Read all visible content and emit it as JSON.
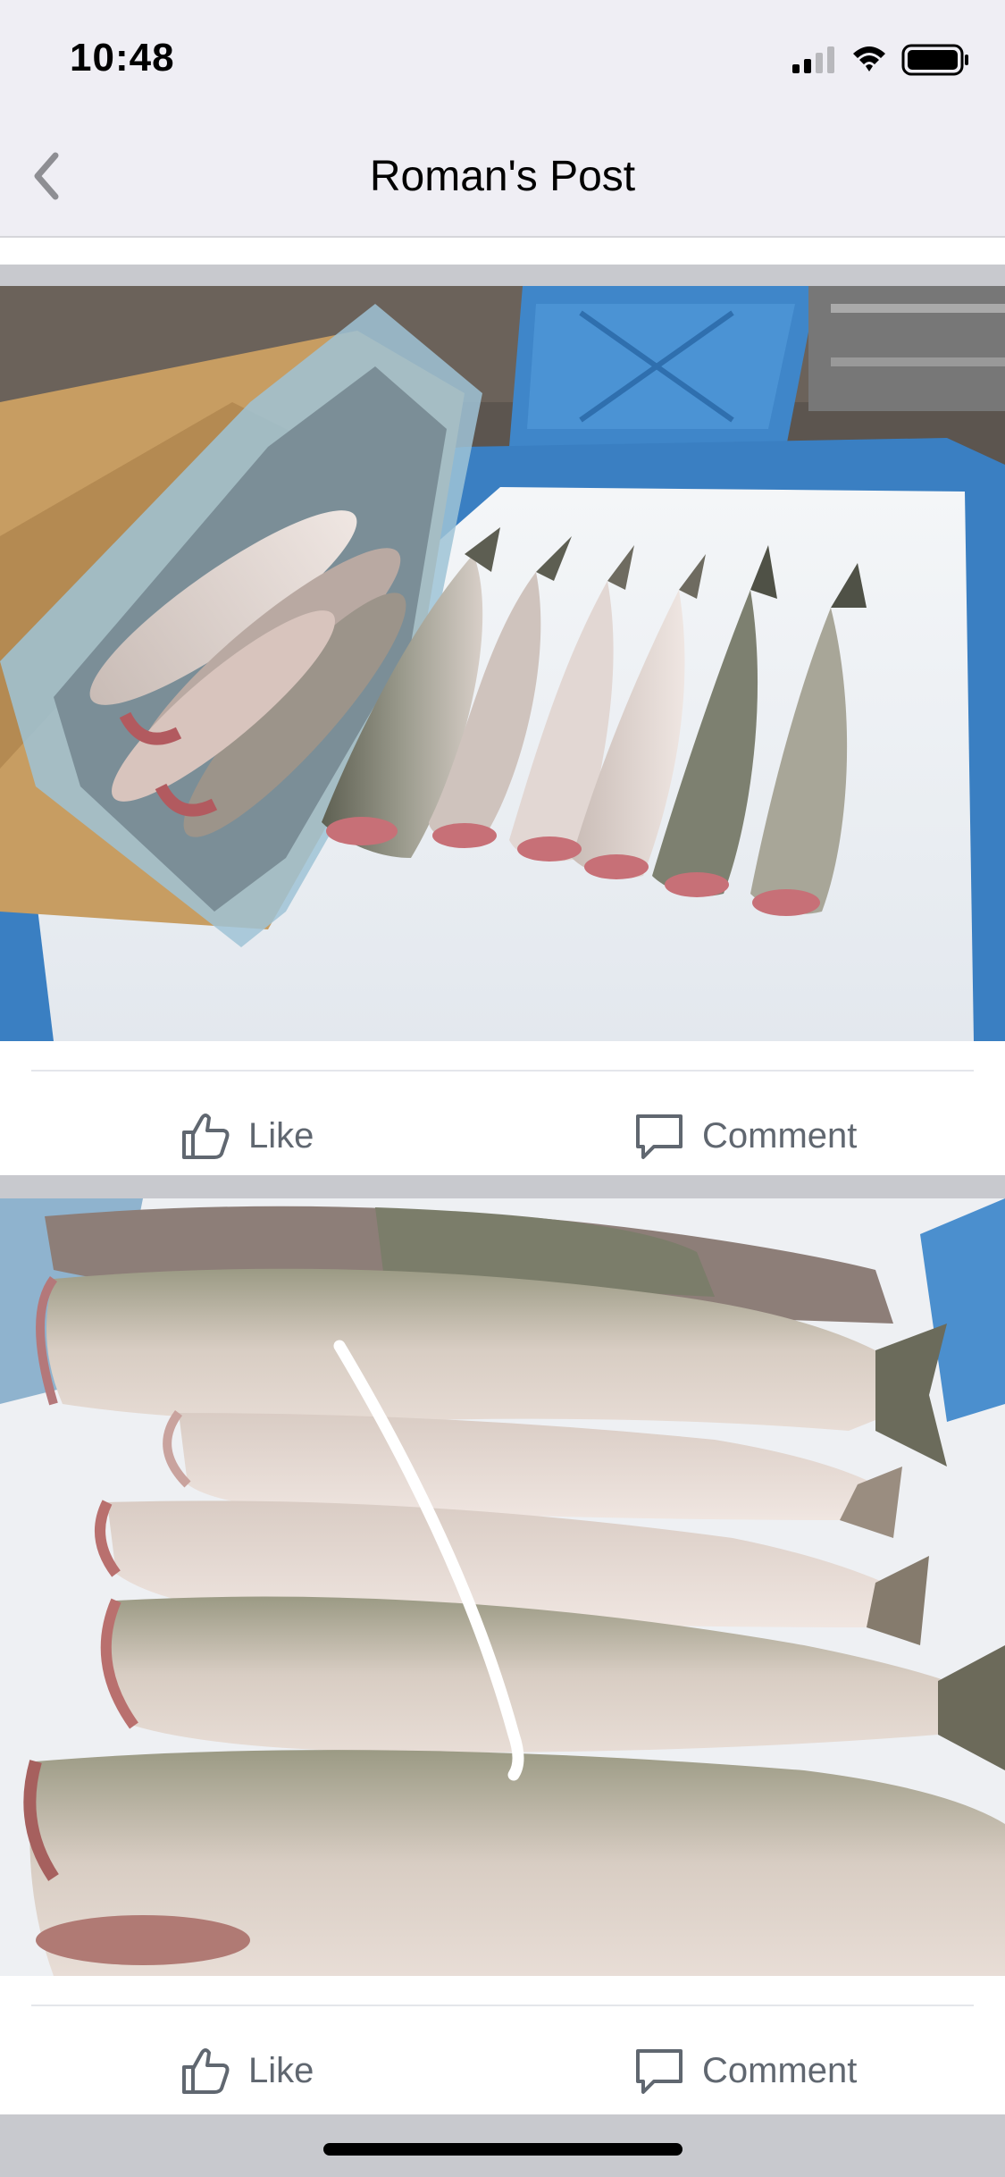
{
  "status_bar": {
    "time": "10:48",
    "icons": [
      "cellular-signal-icon",
      "wifi-icon",
      "battery-icon"
    ]
  },
  "nav": {
    "title": "Roman's Post",
    "back_icon": "chevron-left-icon"
  },
  "posts": [
    {
      "photo_description_icon": "photo",
      "like_label": "Like",
      "comment_label": "Comment"
    },
    {
      "photo_description_icon": "photo",
      "like_label": "Like",
      "comment_label": "Comment"
    }
  ],
  "colors": {
    "bar_background": "#efeef4",
    "separator": "#c8c9ce",
    "action_text": "#606770",
    "crate_blue": "#3f86c9"
  }
}
